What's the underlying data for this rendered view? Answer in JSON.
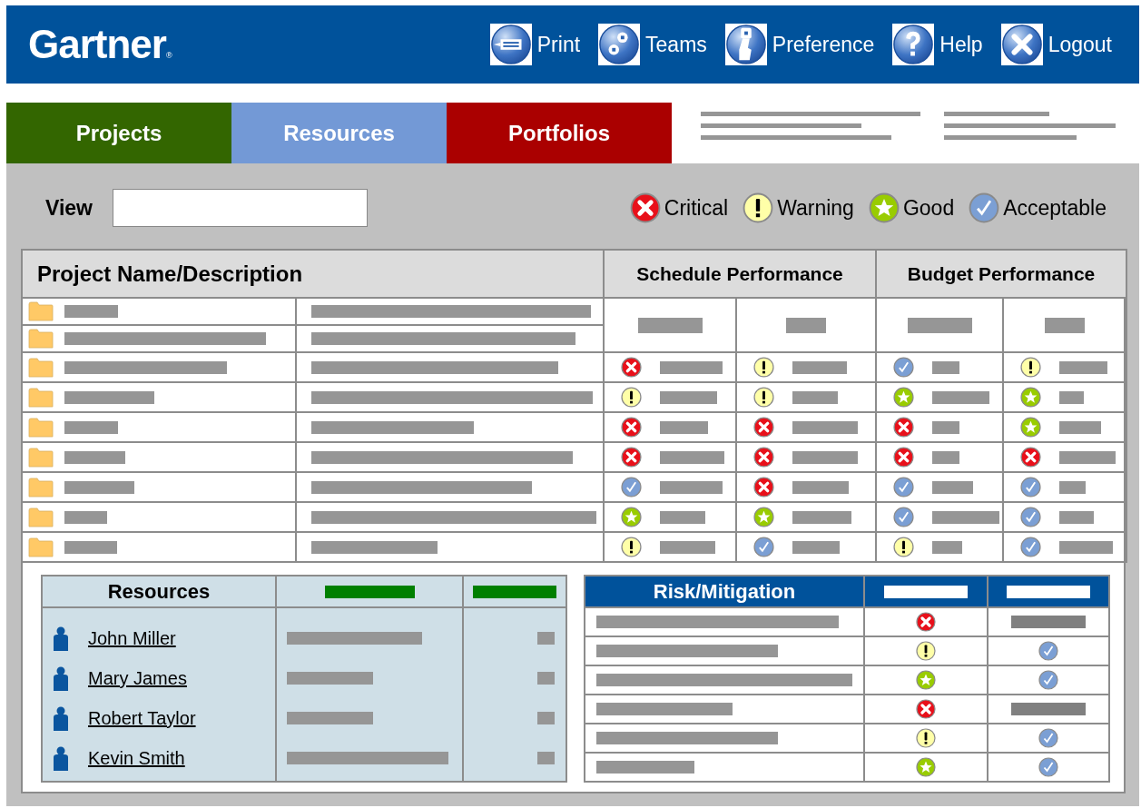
{
  "header": {
    "logo": "Gartner",
    "logo_mark": "®"
  },
  "nav": [
    {
      "kind": "print",
      "label": "Print"
    },
    {
      "kind": "teams",
      "label": "Teams"
    },
    {
      "kind": "preference",
      "label": "Preference"
    },
    {
      "kind": "help",
      "label": "Help"
    },
    {
      "kind": "logout",
      "label": "Logout"
    }
  ],
  "tabs": [
    {
      "label": "Projects",
      "color": "#336600"
    },
    {
      "label": "Resources",
      "color": "#7399d6"
    },
    {
      "label": "Portfolios",
      "color": "#aa0000"
    }
  ],
  "view": {
    "label": "View"
  },
  "legend": [
    {
      "kind": "critical",
      "label": "Critical"
    },
    {
      "kind": "warning",
      "label": "Warning"
    },
    {
      "kind": "good",
      "label": "Good"
    },
    {
      "kind": "acceptable",
      "label": "Acceptable"
    }
  ],
  "projects": {
    "columns": [
      "Project Name/Description",
      "Schedule Performance",
      "Budget Performance"
    ],
    "rows": [
      {
        "statuses": [
          {
            "kind": "critical"
          },
          {
            "kind": "warning"
          },
          {
            "kind": "acceptable"
          },
          {
            "kind": "warning"
          }
        ]
      },
      {
        "statuses": [
          {
            "kind": "warning"
          },
          {
            "kind": "warning"
          },
          {
            "kind": "good"
          },
          {
            "kind": "good"
          }
        ]
      },
      {
        "statuses": [
          {
            "kind": "critical"
          },
          {
            "kind": "critical"
          },
          {
            "kind": "critical"
          },
          {
            "kind": "good"
          }
        ]
      },
      {
        "statuses": [
          {
            "kind": "critical"
          },
          {
            "kind": "critical"
          },
          {
            "kind": "critical"
          },
          {
            "kind": "critical"
          }
        ]
      },
      {
        "statuses": [
          {
            "kind": "acceptable"
          },
          {
            "kind": "critical"
          },
          {
            "kind": "acceptable"
          },
          {
            "kind": "acceptable"
          }
        ]
      },
      {
        "statuses": [
          {
            "kind": "good"
          },
          {
            "kind": "good"
          },
          {
            "kind": "acceptable"
          },
          {
            "kind": "acceptable"
          }
        ]
      },
      {
        "statuses": [
          {
            "kind": "warning"
          },
          {
            "kind": "acceptable"
          },
          {
            "kind": "warning"
          },
          {
            "kind": "acceptable"
          }
        ]
      }
    ]
  },
  "resources": {
    "title": "Resources",
    "people": [
      "John Miller",
      "Mary James",
      "Robert Taylor",
      "Kevin Smith"
    ]
  },
  "risks": {
    "title": "Risk/Mitigation",
    "rows": [
      {
        "kind": "critical",
        "mitigation": {
          "kind": "bar"
        }
      },
      {
        "kind": "warning",
        "mitigation": {
          "kind": "acceptable"
        }
      },
      {
        "kind": "good",
        "mitigation": {
          "kind": "acceptable"
        }
      },
      {
        "kind": "critical",
        "mitigation": {
          "kind": "bar"
        }
      },
      {
        "kind": "warning",
        "mitigation": {
          "kind": "acceptable"
        }
      },
      {
        "kind": "good",
        "mitigation": {
          "kind": "acceptable"
        }
      }
    ]
  }
}
